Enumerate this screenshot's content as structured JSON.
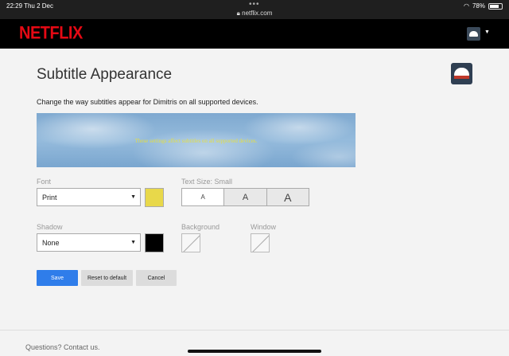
{
  "status_bar": {
    "time_date": "22:29  Thu 2 Dec",
    "url": "netflix.com",
    "battery": "78%",
    "battery_level": 0.78
  },
  "header": {
    "logo": "NETFLIX",
    "profile_icon": "profile-avatar-icon",
    "caret_icon": "caret-down-icon"
  },
  "page": {
    "title": "Subtitle Appearance",
    "description": "Change the way subtitles appear for Dimitris on all supported devices."
  },
  "preview": {
    "sample_text": "These settings affect subtitles on all supported devices."
  },
  "font": {
    "label": "Font",
    "value": "Print",
    "color": "#e8d84a"
  },
  "text_size": {
    "label": "Text Size: Small",
    "options": [
      "A",
      "A",
      "A"
    ],
    "selected": "Small"
  },
  "shadow": {
    "label": "Shadow",
    "value": "None",
    "color": "#000000"
  },
  "background": {
    "label": "Background"
  },
  "window": {
    "label": "Window"
  },
  "buttons": {
    "save": "Save",
    "reset": "Reset to default",
    "cancel": "Cancel"
  },
  "footer": {
    "contact": "Questions? Contact us."
  },
  "colors": {
    "accent": "#2f7dea",
    "brand": "#e50914"
  }
}
